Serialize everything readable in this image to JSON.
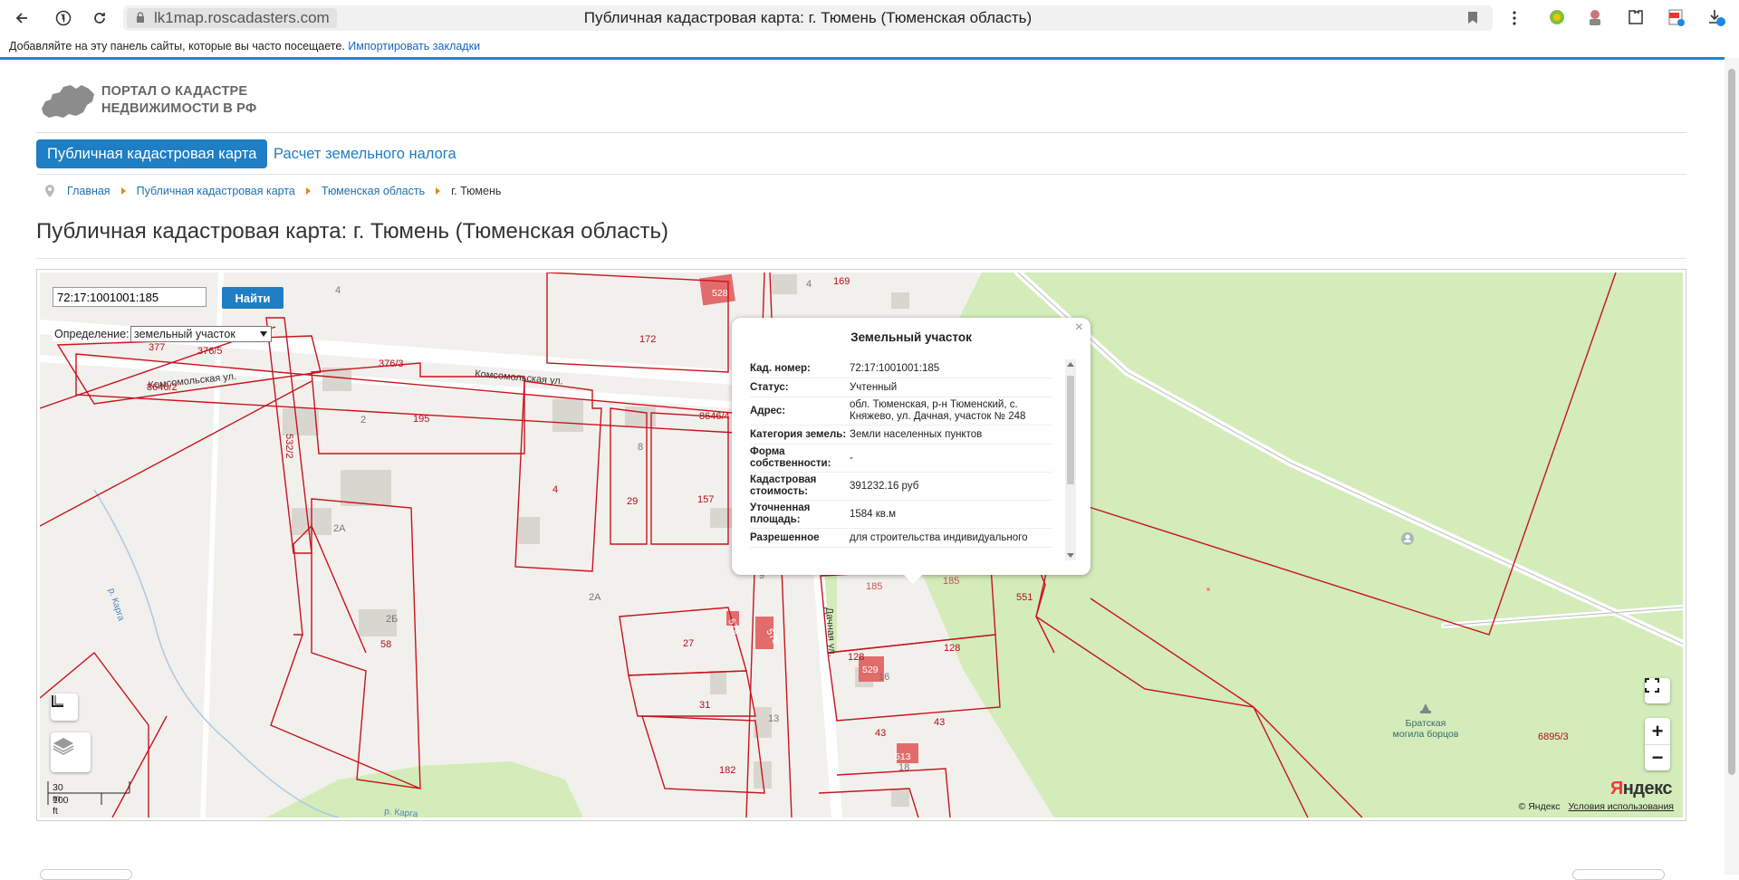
{
  "browser": {
    "url": "lk1map.roscadasters.com",
    "page_title": "Публичная кадастровая карта: г. Тюмень (Тюменская область)",
    "bookmarks_hint": "Добавляйте на эту панель сайты, которые вы часто посещаете.",
    "bookmarks_import": "Импортировать закладки"
  },
  "site": {
    "logo_line1": "ПОРТАЛ О КАДАСТРЕ",
    "logo_line2": "НЕДВИЖИМОСТИ В РФ",
    "tab_active": "Публичная кадастровая карта",
    "tab_tax": "Расчет земельного налога",
    "breadcrumb": [
      "Главная",
      "Публичная кадастровая карта",
      "Тюменская область",
      "г. Тюмень"
    ],
    "heading": "Публичная кадастровая карта: г. Тюмень (Тюменская область)"
  },
  "map": {
    "search_value": "72:17:1001001:185",
    "search_button": "Найти",
    "definition_label": "Определение:",
    "definition_value": "земельный участок",
    "scale_m": "30 m",
    "scale_ft": "100 ft",
    "attribution": "© Яндекс",
    "terms": "Условия использования",
    "yandex_logo_y": "Я",
    "yandex_logo_rest": "ндекс",
    "zoom_in": "+",
    "zoom_out": "−",
    "labels": {
      "street_komsomol": "Комсомольская ул.",
      "street_komsomol2": "Комсомольская ул.",
      "street_dachnaya": "Дачная ул.",
      "river": "р. Карга",
      "river2": "р. Карга",
      "monument_line1": "Братская",
      "monument_line2": "могила борцов"
    },
    "parcels": {
      "p172": "172",
      "p195": "195",
      "p4": "4",
      "p29": "29",
      "p157": "157",
      "p27": "27",
      "p31": "31",
      "p182": "182",
      "p58": "58",
      "p185a": "185",
      "p185b": "185",
      "p551": "551",
      "p128a": "128",
      "p128b": "128",
      "p43a": "43",
      "p43b": "43",
      "p6895": "6895/3",
      "p169": "169",
      "p376": "376/3",
      "p3765": "376/5",
      "p377": "377",
      "p8646": "8646/2",
      "p86464": "8646/4",
      "p532": "532/2",
      "b528": "528",
      "b579": "579",
      "b578": "578",
      "b529": "529",
      "b513": "513"
    },
    "houses": {
      "h4a": "4",
      "h4b": "4",
      "h2": "2",
      "h2a": "2А",
      "h2b": "2Б",
      "h2a2": "2А",
      "h8": "8",
      "h13": "13",
      "h16": "16",
      "h18": "18",
      "h9": "9"
    }
  },
  "popup": {
    "title": "Земельный участок",
    "close": "×",
    "rows": [
      {
        "label": "Кад. номер:",
        "value": "72:17:1001001:185"
      },
      {
        "label": "Статус:",
        "value": "Учтенный"
      },
      {
        "label": "Адрес:",
        "value": "обл. Тюменская, р-н Тюменский, с. Княжево, ул. Дачная, участок № 248"
      },
      {
        "label": "Категория земель:",
        "value": "Земли населенных пунктов"
      },
      {
        "label": "Форма собственности:",
        "value": "-"
      },
      {
        "label": "Кадастровая стоимость:",
        "value": "391232.16 руб"
      },
      {
        "label": "Уточненная площадь:",
        "value": "1584 кв.м"
      },
      {
        "label": "Разрешенное",
        "value": "для строительства индивидуального"
      }
    ]
  },
  "colors": {
    "accent": "#1f7ec4",
    "parcel_line": "#c8141e",
    "green_zone": "#d3ecb9",
    "selected_parcel": "#faeea6",
    "building_red": "#e26c6c"
  }
}
